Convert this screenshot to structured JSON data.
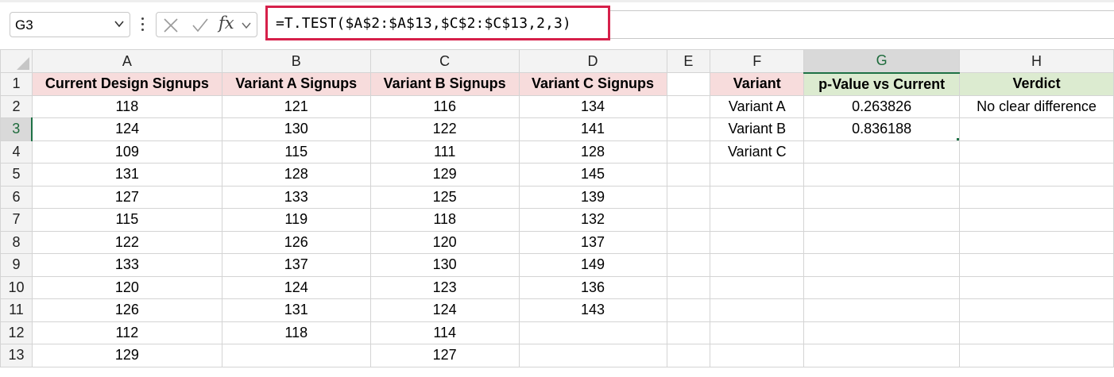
{
  "formula_bar": {
    "name_box": "G3",
    "formula": "=T.TEST($A$2:$A$13,$C$2:$C$13,2,3)",
    "fx_label": "fx",
    "highlight_color": "#d6204a"
  },
  "sheet": {
    "columns": [
      "A",
      "B",
      "C",
      "D",
      "E",
      "F",
      "G",
      "H"
    ],
    "selected_column": "G",
    "selected_row": "3",
    "active_cell": "G3",
    "rows": [
      "1",
      "2",
      "3",
      "4",
      "5",
      "6",
      "7",
      "8",
      "9",
      "10",
      "11",
      "12",
      "13"
    ],
    "headers": {
      "A": "Current Design Signups",
      "B": "Variant A Signups",
      "C": "Variant B Signups",
      "D": "Variant C Signups",
      "F": "Variant",
      "G": "p-Value vs Current",
      "H": "Verdict"
    },
    "data": {
      "A": [
        "118",
        "124",
        "109",
        "131",
        "127",
        "115",
        "122",
        "133",
        "120",
        "126",
        "112",
        "129"
      ],
      "B": [
        "121",
        "130",
        "115",
        "128",
        "133",
        "119",
        "126",
        "137",
        "124",
        "131",
        "118",
        ""
      ],
      "C": [
        "116",
        "122",
        "111",
        "129",
        "125",
        "118",
        "120",
        "130",
        "123",
        "124",
        "114",
        "127"
      ],
      "D": [
        "134",
        "141",
        "128",
        "145",
        "139",
        "132",
        "137",
        "149",
        "136",
        "143",
        "",
        ""
      ]
    },
    "summary": [
      {
        "variant": "Variant A",
        "p_value": "0.263826",
        "verdict": "No clear difference"
      },
      {
        "variant": "Variant B",
        "p_value": "0.836188",
        "verdict": ""
      },
      {
        "variant": "Variant C",
        "p_value": "",
        "verdict": ""
      }
    ],
    "colors": {
      "header_pink": "#f7dcdc",
      "header_green": "#dcebd0",
      "selection_green": "#1e7145"
    }
  }
}
